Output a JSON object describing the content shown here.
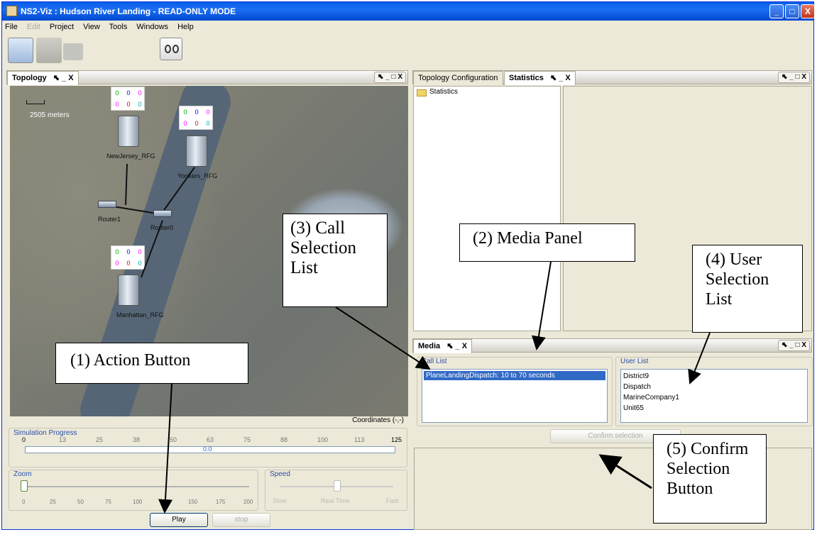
{
  "window": {
    "title": "NS2-Viz : Hudson River Landing - READ-ONLY MODE",
    "min": "_",
    "max": "□",
    "close": "X"
  },
  "menu": [
    "File",
    "Edit",
    "Project",
    "View",
    "Tools",
    "Windows",
    "Help"
  ],
  "topology": {
    "tab": "Topology",
    "tab_ctrls": "⬉ _ X",
    "panel_ctrls": "⬉ _ □ X",
    "scale": "2505 meters",
    "nodes": [
      "NewJersey_RFG",
      "Yonkers_RFG",
      "Router1",
      "Router0",
      "Manhattan_RFG"
    ],
    "counters": {
      "a": [
        "0",
        "0",
        "0"
      ],
      "b": [
        "0",
        "0",
        "0"
      ]
    },
    "coordinates": "Coordinates (-,-)"
  },
  "progress": {
    "label": "Simulation Progress",
    "ticks": [
      "0",
      "13",
      "25",
      "38",
      "50",
      "63",
      "75",
      "88",
      "100",
      "113",
      "125"
    ],
    "value": "0.0"
  },
  "zoom": {
    "label": "Zoom",
    "ticks": [
      "0",
      "25",
      "50",
      "75",
      "100",
      "125",
      "150",
      "175",
      "200"
    ]
  },
  "speed": {
    "label": "Speed",
    "ticks": [
      "Slow",
      "Real Time",
      "Fast"
    ]
  },
  "buttons": {
    "play": "Play",
    "stop": "stop",
    "confirm": "Confirm selection"
  },
  "right_tabs": {
    "topo_config": "Topology Configuration",
    "statistics": "Statistics",
    "tab_ctrls": "⬉ _ X",
    "panel_ctrls": "⬉ _ □ X"
  },
  "stats_tree": "Statistics",
  "media": {
    "tab": "Media",
    "tab_ctrls": "⬉ _ X",
    "panel_ctrls": "⬉ _ □ X",
    "call_list_label": "Call List",
    "call_items": [
      "PlaneLandingDispatch: 10 to 70 seconds"
    ],
    "user_list_label": "User List",
    "user_items": [
      "District9",
      "Dispatch",
      "MarineCompany1",
      "Unit65"
    ]
  },
  "callouts": {
    "action": "(1) Action Button",
    "media": "(2) Media Panel",
    "call": [
      "(3) Call",
      "Selection",
      "List"
    ],
    "user": [
      "(4) User",
      "Selection",
      "List"
    ],
    "confirm": [
      "(5) Confirm",
      "Selection",
      "Button"
    ]
  }
}
